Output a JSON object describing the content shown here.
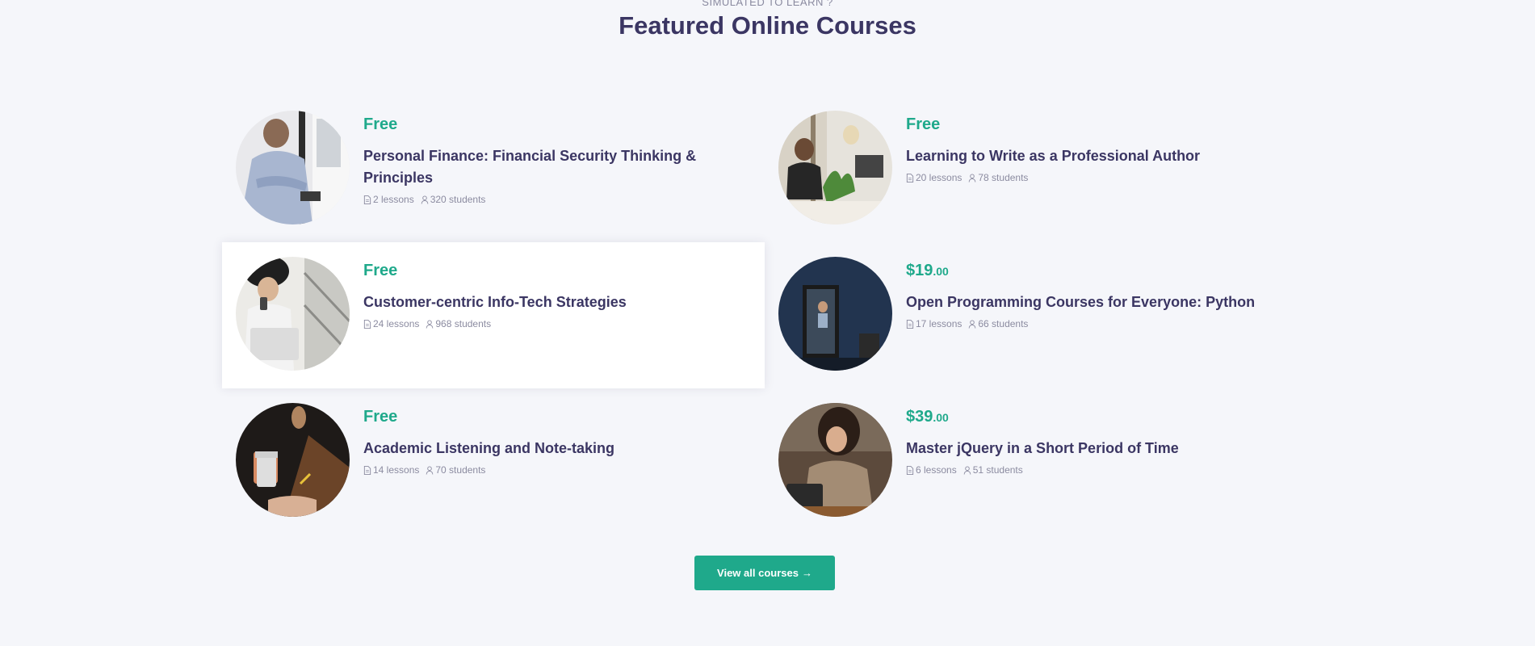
{
  "section": {
    "eyebrow": "SIMULATED TO LEARN ?",
    "title": "Featured Online Courses"
  },
  "courses": [
    {
      "price": "Free",
      "price_cents": "",
      "title": "Personal Finance: Financial Security Thinking & Principles",
      "lessons": "2 lessons",
      "students": "320 students",
      "image": "man-arms-crossed-photo"
    },
    {
      "price": "Free",
      "price_cents": "",
      "title": "Learning to Write as a Professional Author",
      "lessons": "20 lessons",
      "students": "78 students",
      "image": "two-women-office-photo"
    },
    {
      "price": "Free",
      "price_cents": "",
      "title": "Customer-centric Info-Tech Strategies",
      "lessons": "24 lessons",
      "students": "968 students",
      "image": "woman-laptop-phone-photo"
    },
    {
      "price": "$19",
      "price_cents": ".00",
      "title": "Open Programming Courses for Everyone: Python",
      "lessons": "17 lessons",
      "students": "66 students",
      "image": "office-booth-photo"
    },
    {
      "price": "Free",
      "price_cents": "",
      "title": "Academic Listening and Note-taking",
      "lessons": "14 lessons",
      "students": "70 students",
      "image": "coffee-cup-desk-photo"
    },
    {
      "price": "$39",
      "price_cents": ".00",
      "title": "Master jQuery in a Short Period of Time",
      "lessons": "6 lessons",
      "students": "51 students",
      "image": "laughing-woman-photo"
    }
  ],
  "cta": {
    "label": "View all courses",
    "icon": "arrow-right-icon"
  },
  "colors": {
    "accent": "#1fa98b",
    "heading": "#3b3663",
    "muted": "#8b8ba0",
    "background": "#f5f6fa"
  }
}
